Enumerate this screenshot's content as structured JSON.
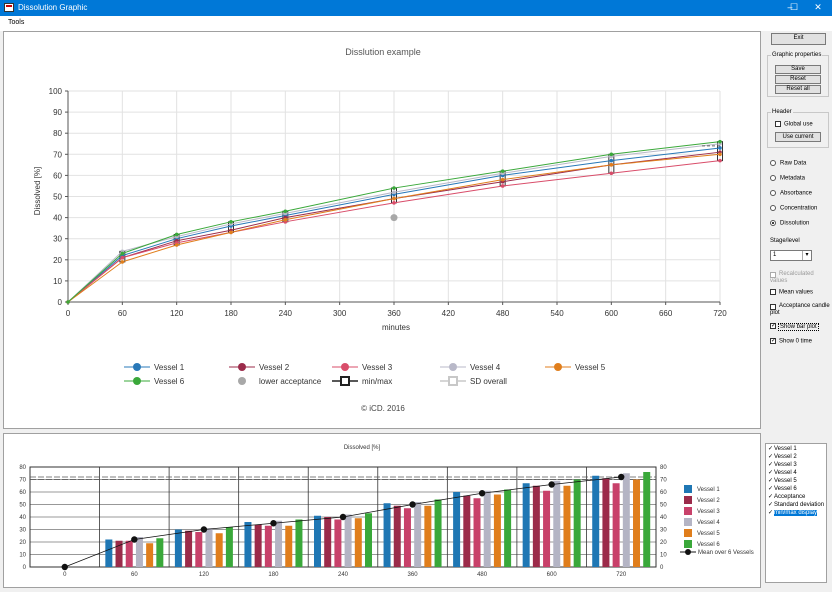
{
  "window": {
    "title": "Dissolution Graphic",
    "controls": [
      "–",
      "☐",
      "✕"
    ]
  },
  "menu": {
    "tools": "Tools"
  },
  "main_chart": {
    "title": "Disslution example",
    "xlabel": "minutes",
    "ylabel": "Dissolved [%]",
    "footer": "© iCD. 2016",
    "legend": [
      {
        "name": "Vessel 1",
        "color": "#2878b8",
        "marker": "circle"
      },
      {
        "name": "Vessel 2",
        "color": "#9b2b4a",
        "marker": "circle"
      },
      {
        "name": "Vessel 3",
        "color": "#d94d6a",
        "marker": "circle"
      },
      {
        "name": "Vessel 4",
        "color": "#b8b8c8",
        "marker": "circle"
      },
      {
        "name": "Vessel 5",
        "color": "#e07e1c",
        "marker": "circle"
      },
      {
        "name": "Vessel 6",
        "color": "#3aa83a",
        "marker": "circle"
      },
      {
        "name": "lower acceptance",
        "color": "#a8a8a8",
        "marker": "dot"
      },
      {
        "name": "min/max",
        "color": "#222222",
        "marker": "box"
      },
      {
        "name": "SD overall",
        "color": "#c8c8c8",
        "marker": "box"
      }
    ]
  },
  "bar_chart": {
    "title": "Dissolved [%]",
    "legend": [
      {
        "name": "Vessel 1",
        "color": "#1f77b4"
      },
      {
        "name": "Vessel 2",
        "color": "#9b2b4a"
      },
      {
        "name": "Vessel 3",
        "color": "#c8416a"
      },
      {
        "name": "Vessel 4",
        "color": "#b4b4c4"
      },
      {
        "name": "Vessel 5",
        "color": "#e07e1c"
      },
      {
        "name": "Vessel 6",
        "color": "#3aa83a"
      }
    ],
    "mean_label": "Mean over 6 Vessels"
  },
  "sidebar": {
    "exit": "Exit",
    "graphic_properties": {
      "legend": "Graphic properties",
      "save": "Save",
      "reset": "Reset",
      "reset_all": "Reset all"
    },
    "header": {
      "legend": "Header",
      "global_use": "Global use",
      "use_current": "Use current"
    },
    "radios": [
      {
        "label": "Raw Data",
        "selected": false
      },
      {
        "label": "Metadata",
        "selected": false
      },
      {
        "label": "Absorbance",
        "selected": false
      },
      {
        "label": "Concentration",
        "selected": false
      },
      {
        "label": "Dissolution",
        "selected": true
      }
    ],
    "stage_label": "Stage/level",
    "stage_value": "1",
    "recalculated": "Recalculated values",
    "mean_values": "Mean values",
    "acceptance_candle": "Acceptance candle plot",
    "show_bar_plot": "Show bar plot",
    "show_0_time": "Show 0 time"
  },
  "series_list": [
    {
      "label": "Vessel 1",
      "checked": true
    },
    {
      "label": "Vessel 2",
      "checked": true
    },
    {
      "label": "Vessel 3",
      "checked": true
    },
    {
      "label": "Vessel 4",
      "checked": true
    },
    {
      "label": "Vessel 5",
      "checked": true
    },
    {
      "label": "Vessel 6",
      "checked": true
    },
    {
      "label": "Acceptance",
      "checked": true
    },
    {
      "label": "Standard deviation",
      "checked": true
    },
    {
      "label": "min/max display",
      "checked": true,
      "selected": true
    }
  ],
  "chart_data": [
    {
      "type": "line",
      "title": "Disslution example",
      "xlabel": "minutes",
      "ylabel": "Dissolved [%]",
      "x": [
        0,
        60,
        120,
        180,
        240,
        360,
        480,
        600,
        720
      ],
      "xticks": [
        0,
        60,
        120,
        180,
        240,
        300,
        360,
        420,
        480,
        540,
        600,
        660,
        720
      ],
      "yticks": [
        0,
        10,
        20,
        30,
        40,
        50,
        60,
        70,
        80,
        90,
        100
      ],
      "xlim": [
        0,
        720
      ],
      "ylim": [
        0,
        100
      ],
      "grid": true,
      "legend_position": "bottom",
      "series": [
        {
          "name": "Vessel 1",
          "color": "#2878b8",
          "values": [
            0,
            22,
            30,
            36,
            41,
            51,
            60,
            67,
            73
          ]
        },
        {
          "name": "Vessel 2",
          "color": "#9b2b4a",
          "values": [
            0,
            21,
            29,
            34,
            40,
            49,
            57,
            65,
            71
          ]
        },
        {
          "name": "Vessel 3",
          "color": "#d94d6a",
          "values": [
            0,
            21,
            28,
            33,
            38,
            47,
            55,
            61,
            67
          ]
        },
        {
          "name": "Vessel 4",
          "color": "#b8b8c8",
          "values": [
            0,
            24,
            31,
            37,
            42,
            52,
            61,
            69,
            75
          ]
        },
        {
          "name": "Vessel 5",
          "color": "#e07e1c",
          "values": [
            0,
            19,
            27,
            33,
            39,
            49,
            58,
            65,
            70
          ]
        },
        {
          "name": "Vessel 6",
          "color": "#3aa83a",
          "values": [
            0,
            23,
            32,
            38,
            43,
            54,
            62,
            70,
            76
          ]
        }
      ],
      "lower_acceptance": {
        "name": "lower acceptance",
        "x": 360,
        "y": 40,
        "color": "#a8a8a8"
      },
      "sd_overall": {
        "name": "SD overall",
        "x": 720,
        "y": 74
      }
    },
    {
      "type": "bar",
      "title": "Dissolved [%]",
      "categories": [
        "0",
        "60",
        "120",
        "180",
        "240",
        "360",
        "480",
        "600",
        "720"
      ],
      "yticks": [
        0,
        10,
        20,
        30,
        40,
        50,
        60,
        70,
        80
      ],
      "ylim": [
        0,
        80
      ],
      "reference_lines": [
        70,
        72
      ],
      "series": [
        {
          "name": "Vessel 1",
          "color": "#1f77b4",
          "values": [
            0,
            22,
            30,
            36,
            41,
            51,
            60,
            67,
            73
          ]
        },
        {
          "name": "Vessel 2",
          "color": "#9b2b4a",
          "values": [
            0,
            21,
            29,
            34,
            40,
            49,
            57,
            65,
            71
          ]
        },
        {
          "name": "Vessel 3",
          "color": "#c8416a",
          "values": [
            0,
            21,
            28,
            33,
            38,
            47,
            55,
            61,
            67
          ]
        },
        {
          "name": "Vessel 4",
          "color": "#b4b4c4",
          "values": [
            0,
            24,
            31,
            37,
            42,
            52,
            61,
            69,
            75
          ]
        },
        {
          "name": "Vessel 5",
          "color": "#e07e1c",
          "values": [
            0,
            19,
            27,
            33,
            39,
            49,
            58,
            65,
            70
          ]
        },
        {
          "name": "Vessel 6",
          "color": "#3aa83a",
          "values": [
            0,
            23,
            32,
            38,
            43,
            54,
            62,
            70,
            76
          ]
        }
      ],
      "mean": {
        "name": "Mean over 6 Vessels",
        "values": [
          0,
          22,
          30,
          35,
          40,
          50,
          59,
          66,
          72
        ]
      }
    }
  ]
}
